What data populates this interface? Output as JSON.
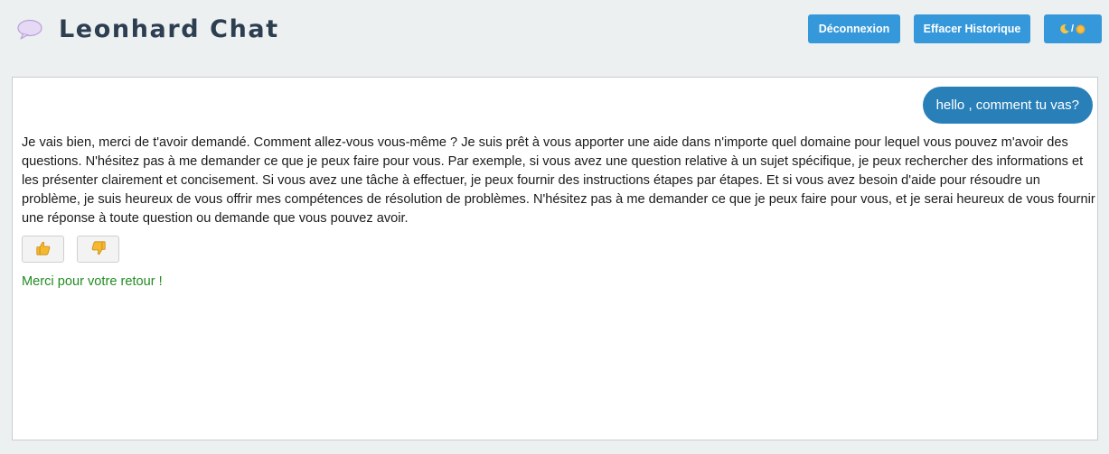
{
  "header": {
    "logo_icon": "speech-bubble-icon",
    "title": "Leonhard Chat",
    "buttons": {
      "logout": "Déconnexion",
      "clear_history": "Effacer Historique",
      "theme_toggle_separator": "/",
      "theme_icons": [
        "moon-icon",
        "sun-icon"
      ]
    },
    "accent_color": "#3498db"
  },
  "chat": {
    "user_message": "hello , comment tu vas?",
    "bot_message": "Je vais bien, merci de t'avoir demandé. Comment allez-vous vous-même ? Je suis prêt à vous apporter une aide dans n'importe quel domaine pour lequel vous pouvez m'avoir des questions. N'hésitez pas à me demander ce que je peux faire pour vous. Par exemple, si vous avez une question relative à un sujet spécifique, je peux rechercher des informations et les présenter clairement et concisement. Si vous avez une tâche à effectuer, je peux fournir des instructions étapes par étapes. Et si vous avez besoin d'aide pour résoudre un problème, je suis heureux de vous offrir mes compétences de résolution de problèmes. N'hésitez pas à me demander ce que je peux faire pour vous, et je serai heureux de vous fournir une réponse à toute question ou demande que vous pouvez avoir.",
    "feedback_buttons": [
      "thumbs-up-icon",
      "thumbs-down-icon"
    ],
    "feedback_message": "Merci pour votre retour !",
    "colors": {
      "user_bubble": "#2980b9",
      "feedback_text": "#218c21"
    }
  }
}
